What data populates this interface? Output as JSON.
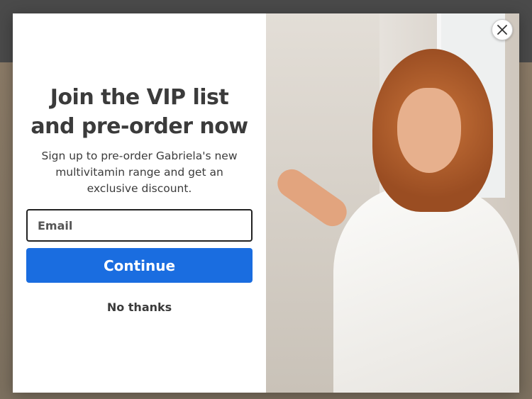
{
  "popup": {
    "headline": "Join the VIP list and pre-order now",
    "subtext": "Sign up to pre-order Gabriela's new multivitamin range and get an exclusive discount.",
    "email_placeholder": "Email",
    "email_value": "",
    "continue_label": "Continue",
    "dismiss_label": "No thanks",
    "close_icon": "close-icon",
    "image_description_icon": "hero-photo"
  },
  "colors": {
    "accent": "#1a6de0",
    "text": "#3b3b3b",
    "background": "#ffffff"
  }
}
